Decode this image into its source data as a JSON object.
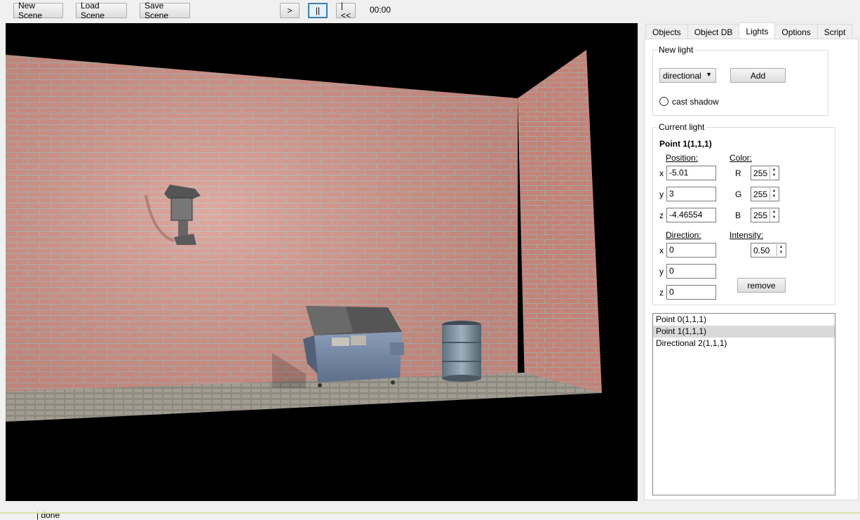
{
  "toolbar": {
    "new_scene": "New Scene",
    "load_scene": "Load Scene",
    "save_scene": "Save Scene",
    "play": ">",
    "pause": "||",
    "rewind": "|<<",
    "time": "00:00"
  },
  "tabs": [
    "Objects",
    "Object DB",
    "Lights",
    "Options",
    "Script"
  ],
  "new_light": {
    "title": "New light",
    "type_value": "directional",
    "add_label": "Add",
    "cast_shadow_label": "cast shadow"
  },
  "current_light": {
    "title": "Current light",
    "name": "Point  1(1,1,1)",
    "position_label": "Position:",
    "color_label": "Color:",
    "pos": {
      "x_label": "x",
      "y_label": "y",
      "z_label": "z",
      "x": "-5.01",
      "y": "3",
      "z": "-4.46554"
    },
    "color": {
      "r_label": "R",
      "g_label": "G",
      "b_label": "B",
      "r": "255",
      "g": "255",
      "b": "255"
    },
    "direction_label": "Direction:",
    "intensity_label": "Intensity:",
    "dir": {
      "x_label": "x",
      "y_label": "y",
      "z_label": "z",
      "x": "0",
      "y": "0",
      "z": "0"
    },
    "intensity": "0.50",
    "remove_label": "remove"
  },
  "lights_list": [
    "Point  0(1,1,1)",
    "Point  1(1,1,1)",
    "Directional  2(1,1,1)"
  ],
  "status": "| done",
  "colors": {
    "accent": "#3c7fb1",
    "selection": "#d9d9d9",
    "viewport_bg": "#000000"
  }
}
